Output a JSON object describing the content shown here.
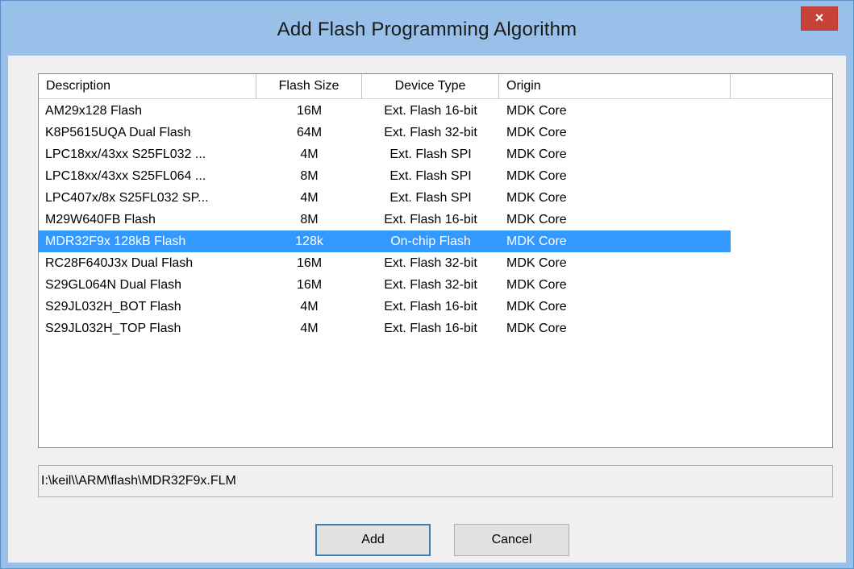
{
  "window": {
    "title": "Add Flash Programming Algorithm",
    "close_glyph": "×"
  },
  "list": {
    "columns": [
      "Description",
      "Flash Size",
      "Device Type",
      "Origin"
    ],
    "selected_index": 6,
    "rows": [
      {
        "description": "AM29x128 Flash",
        "size": "16M",
        "type": "Ext. Flash 16-bit",
        "origin": "MDK Core"
      },
      {
        "description": "K8P5615UQA Dual Flash",
        "size": "64M",
        "type": "Ext. Flash 32-bit",
        "origin": "MDK Core"
      },
      {
        "description": "LPC18xx/43xx S25FL032 ...",
        "size": "4M",
        "type": "Ext. Flash SPI",
        "origin": "MDK Core"
      },
      {
        "description": "LPC18xx/43xx S25FL064 ...",
        "size": "8M",
        "type": "Ext. Flash SPI",
        "origin": "MDK Core"
      },
      {
        "description": "LPC407x/8x S25FL032 SP...",
        "size": "4M",
        "type": "Ext. Flash SPI",
        "origin": "MDK Core"
      },
      {
        "description": "M29W640FB Flash",
        "size": "8M",
        "type": "Ext. Flash 16-bit",
        "origin": "MDK Core"
      },
      {
        "description": "MDR32F9x 128kB Flash",
        "size": "128k",
        "type": "On-chip Flash",
        "origin": "MDK Core"
      },
      {
        "description": "RC28F640J3x Dual Flash",
        "size": "16M",
        "type": "Ext. Flash 32-bit",
        "origin": "MDK Core"
      },
      {
        "description": "S29GL064N Dual Flash",
        "size": "16M",
        "type": "Ext. Flash 32-bit",
        "origin": "MDK Core"
      },
      {
        "description": "S29JL032H_BOT Flash",
        "size": "4M",
        "type": "Ext. Flash 16-bit",
        "origin": "MDK Core"
      },
      {
        "description": "S29JL032H_TOP Flash",
        "size": "4M",
        "type": "Ext. Flash 16-bit",
        "origin": "MDK Core"
      }
    ]
  },
  "path": {
    "value": "I:\\keil\\\\ARM\\flash\\MDR32F9x.FLM"
  },
  "buttons": {
    "add_label": "Add",
    "cancel_label": "Cancel"
  },
  "colors": {
    "selection": "#3399ff",
    "close_button": "#c7433a",
    "title_bar": "#99c0e8"
  }
}
